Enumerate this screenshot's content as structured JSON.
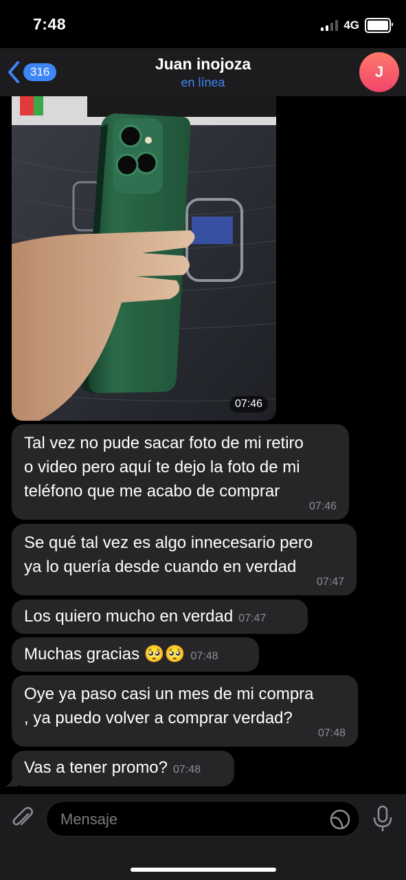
{
  "status_bar": {
    "time": "7:48",
    "network": "4G"
  },
  "header": {
    "back_count": "316",
    "contact_name": "Juan inojoza",
    "status": "en línea",
    "avatar_initial": "J"
  },
  "photo_message": {
    "time": "07:46"
  },
  "messages": [
    {
      "lines": [
        "Tal vez no pude sacar foto de mi retiro",
        "o video pero aquí te dejo la foto de mi",
        "teléfono que me acabo de comprar"
      ],
      "time": "07:46"
    },
    {
      "lines": [
        "Se qué tal vez es algo innecesario pero",
        "ya lo quería desde cuando en verdad"
      ],
      "time": "07:47"
    },
    {
      "lines": [
        "Los quiero mucho en verdad"
      ],
      "time": "07:47"
    },
    {
      "lines": [
        "Muchas gracias 🥺🥺"
      ],
      "time": "07:48"
    },
    {
      "lines": [
        "Oye ya paso casi un mes de mi compra",
        ", ya puedo volver a comprar verdad?"
      ],
      "time": "07:48"
    },
    {
      "lines": [
        "Vas a tener promo?"
      ],
      "time": "07:48"
    }
  ],
  "input": {
    "placeholder": "Mensaje"
  },
  "icons": {
    "back": "chevron-left-icon",
    "attach": "paperclip-icon",
    "sticker": "sticker-icon",
    "mic": "microphone-icon",
    "signal": "signal-icon",
    "battery": "battery-icon"
  },
  "colors": {
    "accent": "#3e86f5",
    "bubble": "#262628",
    "bar": "#1c1c1e",
    "avatar_top": "#ff7a6a",
    "avatar_bottom": "#f0446a"
  }
}
